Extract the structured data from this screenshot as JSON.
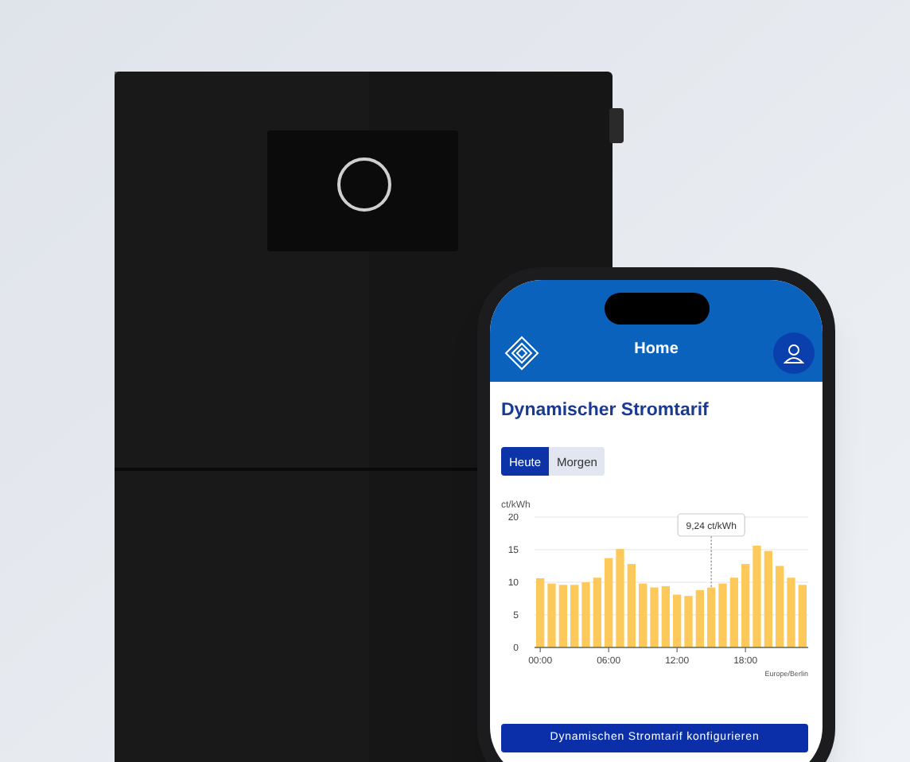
{
  "phone": {
    "header": {
      "title": "Home"
    },
    "card": {
      "title": "Dynamischer Stromtarif",
      "tabs": [
        {
          "label": "Heute",
          "selected": true
        },
        {
          "label": "Morgen",
          "selected": false
        }
      ],
      "chart_data": {
        "type": "bar",
        "xlabel": "Europe/Berlin",
        "ylabel": "ct/kWh",
        "x": [
          0,
          1,
          2,
          3,
          4,
          5,
          6,
          7,
          8,
          9,
          10,
          11,
          12,
          13,
          14,
          15,
          16,
          17,
          18,
          19,
          20,
          21,
          22,
          23
        ],
        "series": [
          {
            "color": "#fcc95a",
            "values": [
              10.6,
              9.8,
              9.6,
              9.6,
              10.0,
              10.7,
              13.7,
              15.1,
              12.8,
              9.8,
              9.2,
              9.4,
              8.1,
              7.9,
              8.8,
              9.2,
              9.8,
              10.7,
              12.8,
              15.6,
              14.8,
              12.5,
              10.7,
              9.6
            ]
          }
        ],
        "xlim": [
          -0.5,
          23.5
        ],
        "ylim": [
          0,
          20
        ],
        "yticks": [
          0,
          5,
          10,
          15,
          20
        ],
        "xticks": [
          {
            "value": 0,
            "label": "00:00"
          },
          {
            "value": 6,
            "label": "06:00"
          },
          {
            "value": 12,
            "label": "12:00"
          },
          {
            "value": 18,
            "label": "18:00"
          }
        ],
        "grid": true,
        "annotations": [
          {
            "x": 15,
            "y": 9.2,
            "text": "9,24 ct/kWh"
          }
        ]
      },
      "button": "Dynamischen Stromtarif konfigurieren"
    }
  }
}
